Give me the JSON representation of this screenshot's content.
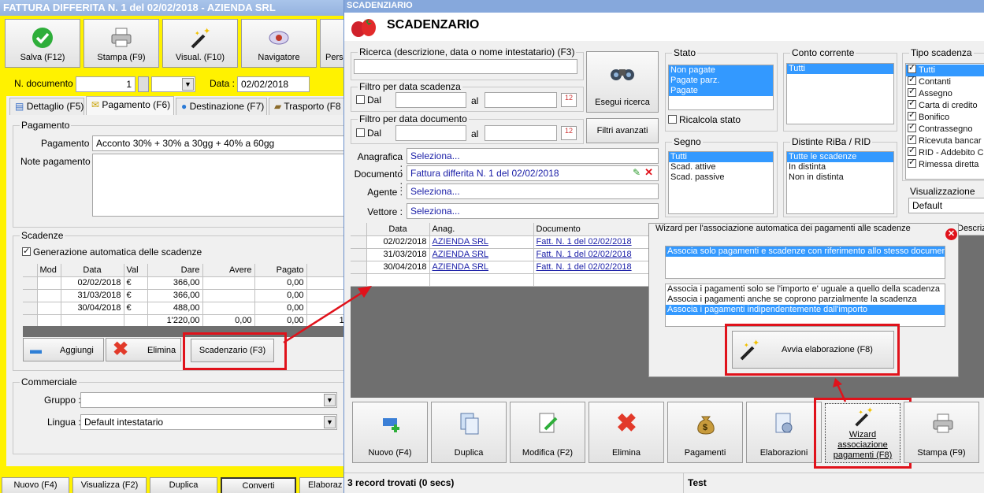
{
  "left_window": {
    "title": "FATTURA DIFFERITA N. 1 del 02/02/2018 - AZIENDA SRL",
    "toolbar": [
      {
        "label": "Salva (F12)",
        "icon": "check-icon"
      },
      {
        "label": "Stampa (F9)",
        "icon": "printer-icon"
      },
      {
        "label": "Visual. (F10)",
        "icon": "wand-icon"
      },
      {
        "label": "Navigatore",
        "icon": "compass-icon"
      },
      {
        "label": "Pers",
        "icon": "person-icon"
      }
    ],
    "ndoc_label": "N. documento :",
    "ndoc_value": "1",
    "data_label": "Data :",
    "data_value": "02/02/2018",
    "tabs": [
      "Dettaglio (F5)",
      "Pagamento (F6)",
      "Destinazione (F7)",
      "Trasporto (F8"
    ],
    "pagamento_group": "Pagamento",
    "pagamento_label": "Pagamento :",
    "pagamento_value": "Acconto 30% + 30% a 30gg + 40% a 60gg",
    "note_label": "Note pagamento :",
    "scadenze_group": "Scadenze",
    "auto_scadenze": "Generazione automatica delle scadenze",
    "grid_headers": [
      "Mod",
      "Data",
      "Val",
      "Dare",
      "Avere",
      "Pagato"
    ],
    "rows": [
      {
        "data": "02/02/2018",
        "val": "€",
        "dare": "366,00",
        "avere": "",
        "pagato": "0,00",
        "extra": "3"
      },
      {
        "data": "31/03/2018",
        "val": "€",
        "dare": "366,00",
        "avere": "",
        "pagato": "0,00",
        "extra": "3"
      },
      {
        "data": "30/04/2018",
        "val": "€",
        "dare": "488,00",
        "avere": "",
        "pagato": "0,00",
        "extra": "4"
      }
    ],
    "totals": {
      "dare": "1'220,00",
      "avere": "0,00",
      "pagato": "0,00",
      "extra": "1'2"
    },
    "aggiungi": "Aggiungi",
    "elimina": "Elimina",
    "scadenzario_btn": "Scadenzario (F3)",
    "commerciale_group": "Commerciale",
    "gruppo_label": "Gruppo :",
    "lingua_label": "Lingua :",
    "lingua_value": "Default intestatario",
    "bottom_buttons": [
      "Nuovo (F4)",
      "Visualizza (F2)",
      "Duplica",
      "Converti",
      "Elaboraz"
    ]
  },
  "right_window": {
    "title": "SCADENZIARIO",
    "header": "SCADENZARIO",
    "ricerca_label": "Ricerca (descrizione, data o nome intestatario) (F3)",
    "esegui_ricerca": "Esegui ricerca",
    "filtri_avanzati": "Filtri avanzati",
    "filtro_scadenza": "Filtro per data scadenza",
    "filtro_documento": "Filtro per data documento",
    "dal": "Dal",
    "al": "al",
    "stato_label": "Stato",
    "stato_items": [
      "Non pagate",
      "Pagate parz.",
      "Pagate"
    ],
    "ricalcola_stato": "Ricalcola stato",
    "conto_label": "Conto corrente",
    "conto_items": [
      "Tutti"
    ],
    "tipo_label": "Tipo scadenza",
    "tipo_items": [
      "Tutti",
      "Contanti",
      "Assegno",
      "Carta di credito",
      "Bonifico",
      "Contrassegno",
      "Ricevuta bancar",
      "RID - Addebito C",
      "Rimessa diretta"
    ],
    "anagrafica_label": "Anagrafica :",
    "anagrafica_value": "Seleziona...",
    "documento_label": "Documento :",
    "documento_value": "Fattura differita N. 1 del 02/02/2018",
    "agente_label": "Agente :",
    "agente_value": "Seleziona...",
    "vettore_label": "Vettore :",
    "vettore_value": "Seleziona...",
    "segno_label": "Segno",
    "segno_items": [
      "Tutti",
      "Scad. attive",
      "Scad. passive"
    ],
    "distinte_label": "Distinte RiBa / RID",
    "distinte_items": [
      "Tutte le scadenze",
      "In distinta",
      "Non in distinta"
    ],
    "visualizzazione_label": "Visualizzazione",
    "visualizzazione_value": "Default",
    "grid_headers": [
      "Data",
      "Anag.",
      "Documento"
    ],
    "rows": [
      {
        "data": "02/02/2018",
        "anag": "AZIENDA SRL",
        "doc": "Fatt. N. 1 del 02/02/2018"
      },
      {
        "data": "31/03/2018",
        "anag": "AZIENDA SRL",
        "doc": "Fatt. N. 1 del 02/02/2018"
      },
      {
        "data": "30/04/2018",
        "anag": "AZIENDA SRL",
        "doc": "Fatt. N. 1 del 02/02/2018"
      }
    ],
    "descrizione_header": "Descrizi",
    "wizard_title": "Wizard per l'associazione automatica dei pagamenti alle scadenze",
    "wizard_option1": "Associa solo pagamenti e scadenze con riferimento allo stesso documento",
    "wizard_options2": [
      "Associa i pagamenti solo se l'importo e' uguale a quello della scadenza",
      "Associa i pagamenti anche se coprono parzialmente la scadenza",
      "Associa i pagamenti indipendentemente dall'importo"
    ],
    "avvia": "Avvia elaborazione (F8)",
    "bottom_buttons": [
      "Nuovo (F4)",
      "Duplica",
      "Modifica (F2)",
      "Elimina",
      "Pagamenti",
      "Elaborazioni",
      "Wizard associazione pagamenti (F8)",
      "Stampa (F9)"
    ],
    "status_left": "3 record trovati (0 secs)",
    "status_right": "Test"
  },
  "colors": {
    "accent_yellow": "#fff200",
    "selection": "#3399ff",
    "highlight_red": "#e0121b",
    "grid_dark": "#6f6f6f"
  }
}
